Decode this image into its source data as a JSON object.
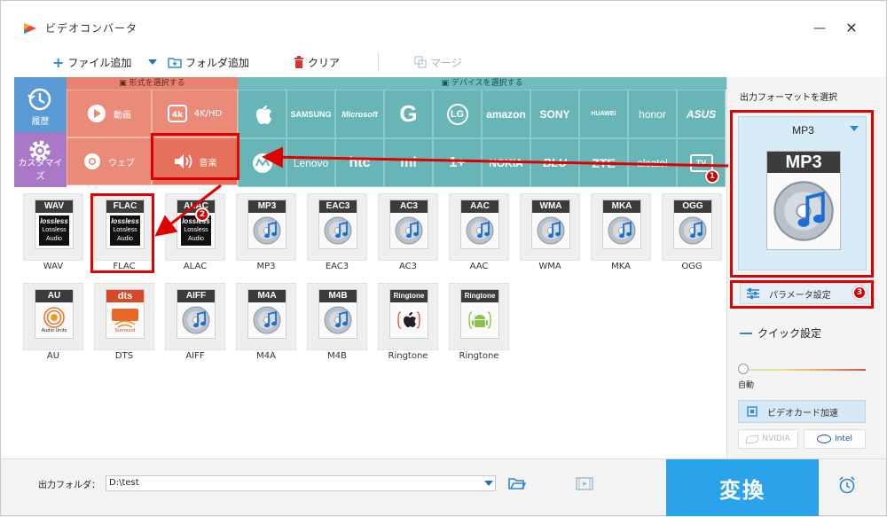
{
  "window": {
    "title": "ビデオコンバータ"
  },
  "toolbar": {
    "add_file": "ファイル追加",
    "add_folder": "フォルダ追加",
    "clear": "クリア",
    "merge": "マージ"
  },
  "sidebar": {
    "history": "履歴",
    "customize": "カスタマイズ"
  },
  "categories": {
    "format_header": "形式を選択する",
    "device_header": "デバイスを選択する",
    "video": "動画",
    "hd": "4K/HD",
    "web": "ウェブ",
    "music": "音楽"
  },
  "devices_row1": [
    "SAMSUNG",
    "Microsoft",
    "G",
    "LG",
    "amazon",
    "SONY",
    "HUAWEI",
    "honor",
    "ASUS"
  ],
  "devices_row2": [
    "Lenovo",
    "htc",
    "mi",
    "1+",
    "NOKIA",
    "BLU",
    "ZTE",
    "alcatel",
    "TV"
  ],
  "formats": [
    {
      "tag": "WAV",
      "label": "WAV",
      "art": "lossless"
    },
    {
      "tag": "FLAC",
      "label": "FLAC",
      "art": "lossless"
    },
    {
      "tag": "ALAC",
      "label": "ALAC",
      "art": "lossless"
    },
    {
      "tag": "MP3",
      "label": "MP3",
      "art": "disc"
    },
    {
      "tag": "EAC3",
      "label": "EAC3",
      "art": "disc"
    },
    {
      "tag": "AC3",
      "label": "AC3",
      "art": "disc"
    },
    {
      "tag": "AAC",
      "label": "AAC",
      "art": "disc"
    },
    {
      "tag": "WMA",
      "label": "WMA",
      "art": "disc"
    },
    {
      "tag": "MKA",
      "label": "MKA",
      "art": "disc"
    },
    {
      "tag": "OGG",
      "label": "OGG",
      "art": "disc"
    },
    {
      "tag": "AU",
      "label": "AU",
      "art": "au"
    },
    {
      "tag": "dts",
      "label": "DTS",
      "art": "dts"
    },
    {
      "tag": "AIFF",
      "label": "AIFF",
      "art": "disc"
    },
    {
      "tag": "M4A",
      "label": "M4A",
      "art": "disc"
    },
    {
      "tag": "M4B",
      "label": "M4B",
      "art": "disc"
    },
    {
      "tag": "Ringtone",
      "label": "Ringtone",
      "art": "apple"
    },
    {
      "tag": "Ringtone",
      "label": "Ringtone",
      "art": "android"
    }
  ],
  "lossless_text": {
    "line1": "lossless",
    "line2": "Lossless",
    "line3": "Audio"
  },
  "au_text": "Audio Units",
  "dts_text": "Surround",
  "right_panel": {
    "title": "出力フォーマットを選択",
    "selected_format": "MP3",
    "preview_tag": "MP3",
    "param_button": "パラメータ設定",
    "quick_settings": "クイック設定",
    "slider_label": "自動",
    "slider_level": 0,
    "gpu_button": "ビデオカード加速",
    "vendor_nvidia": "NVIDIA",
    "vendor_intel": "Intel"
  },
  "bottom": {
    "output_label": "出力フォルダ：",
    "output_path": "D:\\test",
    "convert": "変換"
  },
  "annotations": {
    "badge1": "1",
    "badge2": "2",
    "badge3": "3"
  },
  "colors": {
    "accent": "#2ba3ea",
    "format_bg": "#e98b78",
    "device_bg": "#68b5b7",
    "annotation": "#e00000"
  }
}
